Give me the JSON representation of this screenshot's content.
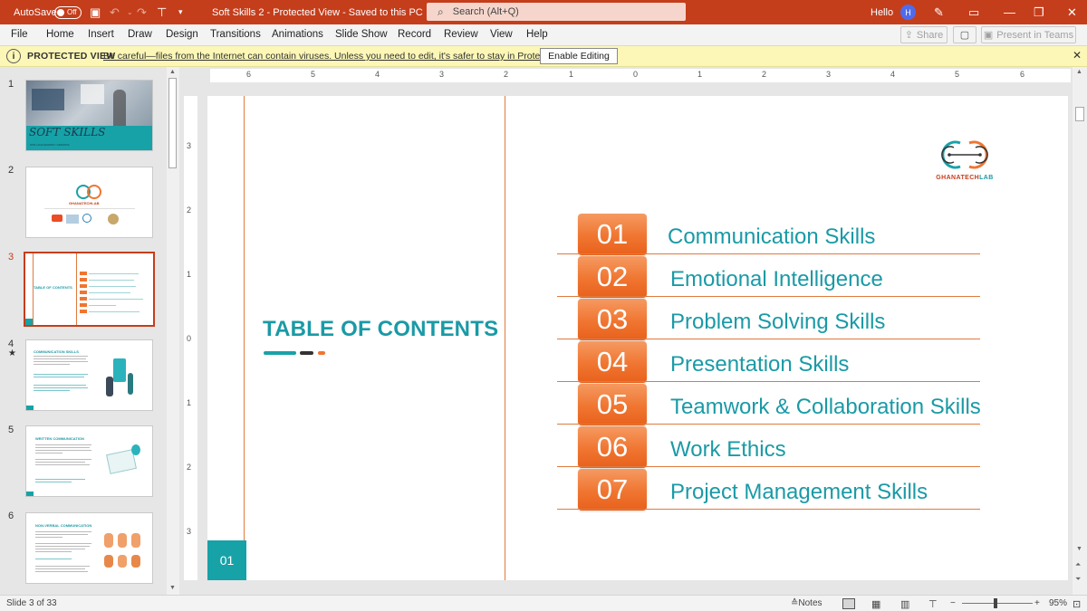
{
  "titlebar": {
    "autosave_label": "AutoSave",
    "autosave_state": "Off",
    "doc_title": "Soft Skills 2  -  Protected View  -  Saved to this PC",
    "search_placeholder": "Search (Alt+Q)",
    "greeting": "Hello",
    "avatar_initial": "H"
  },
  "ribbon": {
    "tabs": [
      "File",
      "Home",
      "Insert",
      "Draw",
      "Design",
      "Transitions",
      "Animations",
      "Slide Show",
      "Record",
      "Review",
      "View",
      "Help"
    ],
    "share_label": "Share",
    "teams_label": "Present in Teams"
  },
  "protected_bar": {
    "title": "PROTECTED VIEW",
    "message": "Be careful—files from the Internet can contain viruses. Unless you need to edit, it's safer to stay in Protected View.",
    "enable_label": "Enable Editing"
  },
  "thumbnails": [
    {
      "num": "1",
      "caption": "SOFT SKILLS",
      "subcaption": "WITH ANA MARISKY GRIFFINS"
    },
    {
      "num": "2",
      "brand": "GHANATECHLAB"
    },
    {
      "num": "3",
      "title": "TABLE OF CONTENTS",
      "active": true
    },
    {
      "num": "4",
      "title": "COMMUNICATION SKILLS",
      "star": "★"
    },
    {
      "num": "5",
      "title": "WRITTEN COMMUNICATION"
    },
    {
      "num": "6",
      "title": "NON-VERBAL COMMUNICATION"
    }
  ],
  "ruler": {
    "h_labels": [
      "6",
      "5",
      "4",
      "3",
      "2",
      "1",
      "0",
      "1",
      "2",
      "3",
      "4",
      "5",
      "6"
    ],
    "v_labels": [
      "3",
      "2",
      "1",
      "0",
      "1",
      "2",
      "3"
    ]
  },
  "slide": {
    "title": "TABLE OF CONTENTS",
    "page_number": "01",
    "logo_text": {
      "part1": "GHANA",
      "part2": "TECH",
      "part3": "LAB"
    },
    "items": [
      {
        "num": "01",
        "label": "Communication Skills"
      },
      {
        "num": "02",
        "label": "Emotional Intelligence"
      },
      {
        "num": "03",
        "label": "Problem Solving Skills"
      },
      {
        "num": "04",
        "label": "Presentation Skills"
      },
      {
        "num": "05",
        "label": "Teamwork & Collaboration Skills"
      },
      {
        "num": "06",
        "label": "Work Ethics"
      },
      {
        "num": "07",
        "label": "Project Management Skills"
      }
    ]
  },
  "statusbar": {
    "slide_info": "Slide 3 of 33",
    "notes_label": "Notes",
    "zoom": "95%"
  },
  "colors": {
    "accent": "#c43e1c",
    "teal": "#1a9aa6",
    "orange": "#f07530"
  }
}
